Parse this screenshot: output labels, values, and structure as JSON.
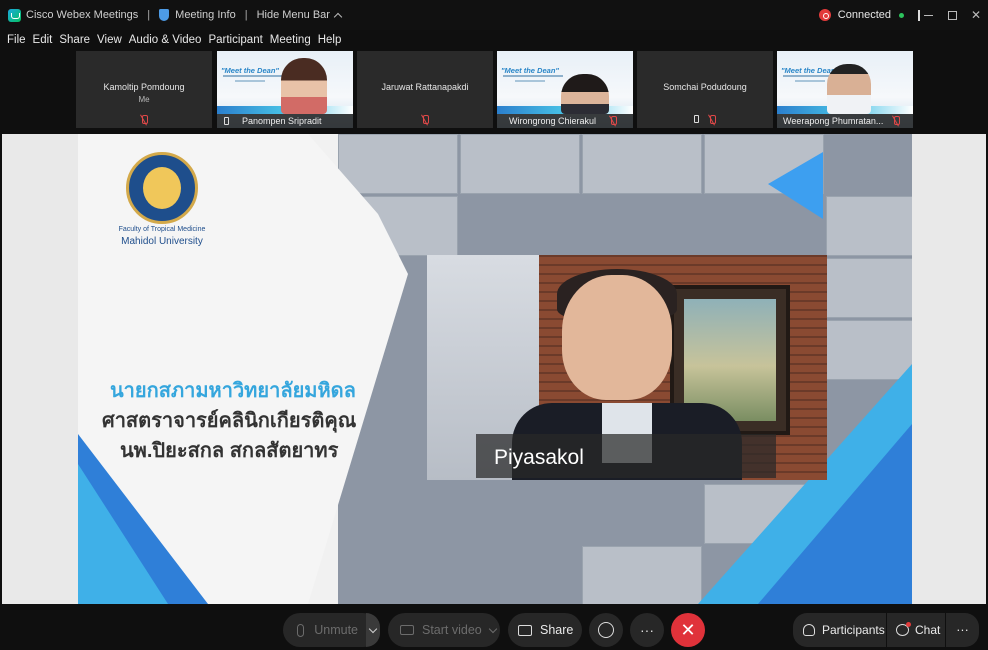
{
  "titlebar": {
    "app_name": "Cisco Webex Meetings",
    "meeting_info": "Meeting Info",
    "hide_menu": "Hide Menu Bar",
    "status": "Connected"
  },
  "menu": [
    "File",
    "Edit",
    "Share",
    "View",
    "Audio & Video",
    "Participant",
    "Meeting",
    "Help"
  ],
  "participants": [
    {
      "name": "Kamoltip Pomdoung",
      "sub": "Me",
      "video": false
    },
    {
      "name": "Panompen Sripradit",
      "video": true
    },
    {
      "name": "Jaruwat Rattanapakdi",
      "video": false
    },
    {
      "name": "Wirongrong Chierakul",
      "video": true
    },
    {
      "name": "Somchai Podudoung",
      "video": false
    },
    {
      "name": "Weerapong Phumratan...",
      "video": true
    }
  ],
  "slide_tile_title": "\"Meet the Dean\"",
  "stage": {
    "faculty_line": "Faculty of Tropical Medicine",
    "university": "Mahidol University",
    "thai_line1": "นายกสภามหาวิทยาลัยมหิดล",
    "thai_line2": "ศาสตราจารย์คลินิกเกียรติคุณ",
    "thai_line3": "นพ.ปิยะสกล สกลสัตยาทร",
    "speaker_name": "Piyasakol"
  },
  "toolbar": {
    "unmute": "Unmute",
    "start_video": "Start video",
    "share": "Share",
    "more": "···",
    "participants": "Participants",
    "chat": "Chat"
  },
  "colors": {
    "accent_blue": "#35a6dd",
    "end_red": "#e0323a",
    "connected_green": "#2cc35c"
  }
}
